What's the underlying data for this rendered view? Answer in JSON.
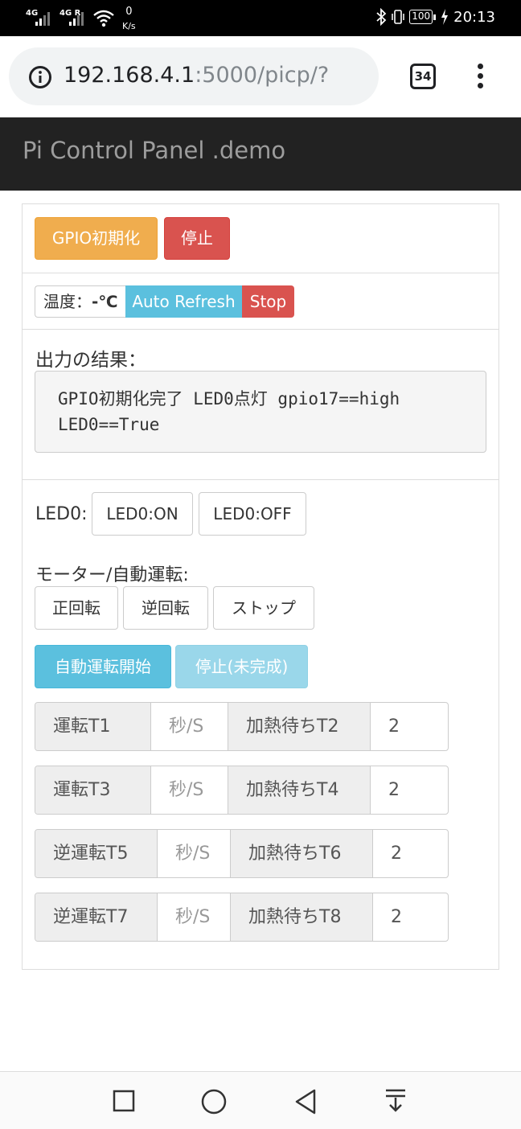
{
  "status_bar": {
    "net1": "4G",
    "net2": "4G R",
    "speed_value": "0",
    "speed_unit": "K/s",
    "battery": "100",
    "time": "20:13"
  },
  "browser": {
    "url_host": "192.168.4.1",
    "url_path": ":5000/picp/?",
    "tab_count": "34"
  },
  "navbar": {
    "brand": "Pi Control Panel .demo"
  },
  "gpio": {
    "init_label": "GPIO初期化",
    "stop_label": "停止"
  },
  "temperature": {
    "label": "温度：",
    "value": "-℃",
    "auto_refresh_label": "Auto Refresh",
    "stop_label": "Stop"
  },
  "output": {
    "title": "出力の结果：",
    "line1": "GPIO初期化完了 LED0点灯 gpio17==high",
    "line2": "LED0==True"
  },
  "led": {
    "label": "LED0:",
    "on_label": "LED0:ON",
    "off_label": "LED0:OFF"
  },
  "motor": {
    "label": "モーター/自動運転:",
    "forward_label": "正回転",
    "reverse_label": "逆回転",
    "stop_label": "ストップ",
    "auto_start_label": "自動運転開始",
    "auto_stop_label": "停止(未完成)"
  },
  "timers": [
    {
      "label_a": "運転T1",
      "placeholder_a": "秒/S",
      "label_b": "加熱待ちT2",
      "value_b": "2"
    },
    {
      "label_a": "運転T3",
      "placeholder_a": "秒/S",
      "label_b": "加熱待ちT4",
      "value_b": "2"
    },
    {
      "label_a": "逆運転T5",
      "placeholder_a": "秒/S",
      "label_b": "加熱待ちT6",
      "value_b": "2"
    },
    {
      "label_a": "逆運転T7",
      "placeholder_a": "秒/S",
      "label_b": "加熱待ちT8",
      "value_b": "2"
    }
  ]
}
